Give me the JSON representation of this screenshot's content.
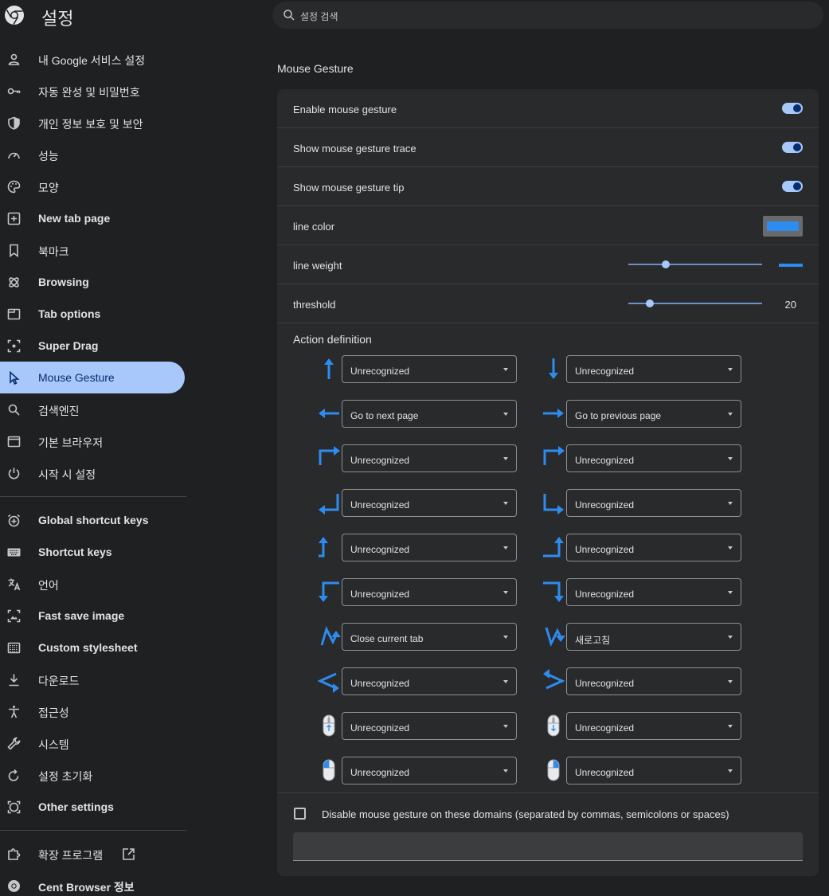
{
  "header": {
    "title": "설정",
    "search_placeholder": "설정 검색"
  },
  "sidebar": {
    "group1": [
      {
        "label": "내 Google 서비스 설정",
        "icon": "person-icon",
        "bold": false
      },
      {
        "label": "자동 완성 및 비밀번호",
        "icon": "key-icon",
        "bold": false
      },
      {
        "label": "개인 정보 보호 및 보안",
        "icon": "shield-icon",
        "bold": false
      },
      {
        "label": "성능",
        "icon": "speedometer-icon",
        "bold": false
      },
      {
        "label": "모양",
        "icon": "palette-icon",
        "bold": false
      },
      {
        "label": "New tab page",
        "icon": "new-tab-icon",
        "bold": true
      },
      {
        "label": "북마크",
        "icon": "bookmark-icon",
        "bold": false
      },
      {
        "label": "Browsing",
        "icon": "atom-icon",
        "bold": true
      },
      {
        "label": "Tab options",
        "icon": "tab-icon",
        "bold": true
      },
      {
        "label": "Super Drag",
        "icon": "drag-icon",
        "bold": true
      },
      {
        "label": "Mouse Gesture",
        "icon": "cursor-icon",
        "bold": false,
        "active": true
      },
      {
        "label": "검색엔진",
        "icon": "search-icon",
        "bold": false
      },
      {
        "label": "기본 브라우저",
        "icon": "browser-icon",
        "bold": false
      },
      {
        "label": "시작 시 설정",
        "icon": "power-icon",
        "bold": false
      }
    ],
    "group2": [
      {
        "label": "Global shortcut keys",
        "icon": "alarm-icon",
        "bold": true
      },
      {
        "label": "Shortcut keys",
        "icon": "keyboard-icon",
        "bold": true
      },
      {
        "label": "언어",
        "icon": "translate-icon",
        "bold": false
      },
      {
        "label": "Fast save image",
        "icon": "image-save-icon",
        "bold": true
      },
      {
        "label": "Custom stylesheet",
        "icon": "stylesheet-icon",
        "bold": true
      },
      {
        "label": "다운로드",
        "icon": "download-icon",
        "bold": false
      },
      {
        "label": "접근성",
        "icon": "accessibility-icon",
        "bold": false
      },
      {
        "label": "시스템",
        "icon": "wrench-icon",
        "bold": false
      },
      {
        "label": "설정 초기화",
        "icon": "reset-icon",
        "bold": false
      },
      {
        "label": "Other settings",
        "icon": "other-settings-icon",
        "bold": true
      }
    ],
    "group3": [
      {
        "label": "확장 프로그램",
        "icon": "puzzle-icon",
        "bold": false,
        "external": true
      },
      {
        "label": "Cent Browser 정보",
        "icon": "browser-logo-icon",
        "bold": true
      }
    ]
  },
  "main": {
    "section_title": "Mouse Gesture",
    "rows": {
      "enable": {
        "label": "Enable mouse gesture",
        "on": true
      },
      "trace": {
        "label": "Show mouse gesture trace",
        "on": true
      },
      "tip": {
        "label": "Show mouse gesture tip",
        "on": true
      },
      "line_color": {
        "label": "line color",
        "color": "#2e8cf0"
      },
      "line_weight": {
        "label": "line weight",
        "level": 0.28
      },
      "threshold": {
        "label": "threshold",
        "value": "20",
        "level": 0.16
      }
    },
    "actions_title": "Action definition",
    "gestures": [
      {
        "icon": "up-arrow-icon",
        "value": "Unrecognized"
      },
      {
        "icon": "down-arrow-icon",
        "value": "Unrecognized"
      },
      {
        "icon": "left-arrow-icon",
        "value": "Go to next page"
      },
      {
        "icon": "right-arrow-icon",
        "value": "Go to previous page"
      },
      {
        "icon": "down-left-arrow-icon",
        "value": "Unrecognized"
      },
      {
        "icon": "down-right-arrow-icon",
        "value": "Unrecognized"
      },
      {
        "icon": "right-up-left-arrow-icon",
        "value": "Unrecognized"
      },
      {
        "icon": "left-down-right-arrow-icon",
        "value": "Unrecognized"
      },
      {
        "icon": "up-left-corner-icon",
        "value": "Unrecognized"
      },
      {
        "icon": "up-right-corner-icon",
        "value": "Unrecognized"
      },
      {
        "icon": "left-down-corner-icon",
        "value": "Unrecognized"
      },
      {
        "icon": "right-down-corner-icon",
        "value": "Unrecognized"
      },
      {
        "icon": "up-down-zigzag-icon",
        "value": "Close current tab"
      },
      {
        "icon": "down-up-zigzag-icon",
        "value": "새로고침"
      },
      {
        "icon": "left-chevron-gesture-icon",
        "value": "Unrecognized"
      },
      {
        "icon": "right-chevron-gesture-icon",
        "value": "Unrecognized"
      },
      {
        "icon": "mouse-wheel-up-icon",
        "value": "Unrecognized"
      },
      {
        "icon": "mouse-wheel-down-icon",
        "value": "Unrecognized"
      },
      {
        "icon": "mouse-left-click-icon",
        "value": "Unrecognized"
      },
      {
        "icon": "mouse-right-click-icon",
        "value": "Unrecognized"
      }
    ],
    "disable_domains": {
      "label": "Disable mouse gesture on these domains (separated by commas, semicolons or spaces)",
      "checked": false,
      "value": ""
    }
  },
  "colors": {
    "accent": "#a8c7fa",
    "gesture_blue": "#2e8cf0"
  }
}
